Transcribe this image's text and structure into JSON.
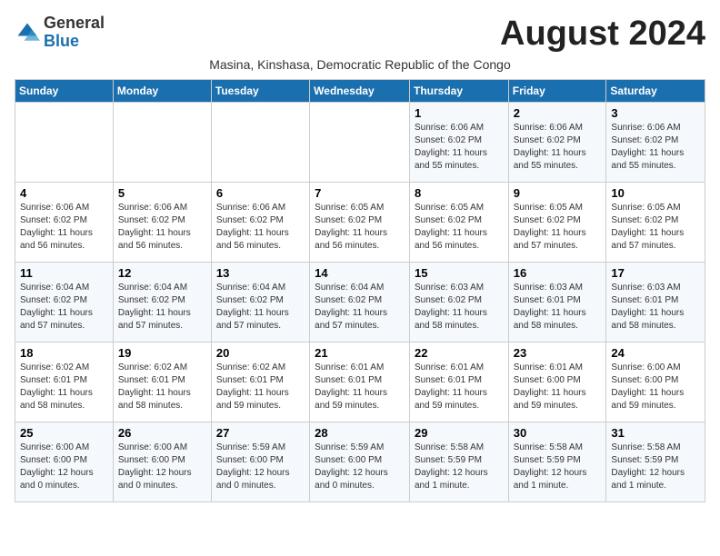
{
  "header": {
    "logo_line1": "General",
    "logo_line2": "Blue",
    "month_title": "August 2024",
    "subtitle": "Masina, Kinshasa, Democratic Republic of the Congo"
  },
  "columns": [
    "Sunday",
    "Monday",
    "Tuesday",
    "Wednesday",
    "Thursday",
    "Friday",
    "Saturday"
  ],
  "weeks": [
    [
      {
        "day": "",
        "info": ""
      },
      {
        "day": "",
        "info": ""
      },
      {
        "day": "",
        "info": ""
      },
      {
        "day": "",
        "info": ""
      },
      {
        "day": "1",
        "info": "Sunrise: 6:06 AM\nSunset: 6:02 PM\nDaylight: 11 hours\nand 55 minutes."
      },
      {
        "day": "2",
        "info": "Sunrise: 6:06 AM\nSunset: 6:02 PM\nDaylight: 11 hours\nand 55 minutes."
      },
      {
        "day": "3",
        "info": "Sunrise: 6:06 AM\nSunset: 6:02 PM\nDaylight: 11 hours\nand 55 minutes."
      }
    ],
    [
      {
        "day": "4",
        "info": "Sunrise: 6:06 AM\nSunset: 6:02 PM\nDaylight: 11 hours\nand 56 minutes."
      },
      {
        "day": "5",
        "info": "Sunrise: 6:06 AM\nSunset: 6:02 PM\nDaylight: 11 hours\nand 56 minutes."
      },
      {
        "day": "6",
        "info": "Sunrise: 6:06 AM\nSunset: 6:02 PM\nDaylight: 11 hours\nand 56 minutes."
      },
      {
        "day": "7",
        "info": "Sunrise: 6:05 AM\nSunset: 6:02 PM\nDaylight: 11 hours\nand 56 minutes."
      },
      {
        "day": "8",
        "info": "Sunrise: 6:05 AM\nSunset: 6:02 PM\nDaylight: 11 hours\nand 56 minutes."
      },
      {
        "day": "9",
        "info": "Sunrise: 6:05 AM\nSunset: 6:02 PM\nDaylight: 11 hours\nand 57 minutes."
      },
      {
        "day": "10",
        "info": "Sunrise: 6:05 AM\nSunset: 6:02 PM\nDaylight: 11 hours\nand 57 minutes."
      }
    ],
    [
      {
        "day": "11",
        "info": "Sunrise: 6:04 AM\nSunset: 6:02 PM\nDaylight: 11 hours\nand 57 minutes."
      },
      {
        "day": "12",
        "info": "Sunrise: 6:04 AM\nSunset: 6:02 PM\nDaylight: 11 hours\nand 57 minutes."
      },
      {
        "day": "13",
        "info": "Sunrise: 6:04 AM\nSunset: 6:02 PM\nDaylight: 11 hours\nand 57 minutes."
      },
      {
        "day": "14",
        "info": "Sunrise: 6:04 AM\nSunset: 6:02 PM\nDaylight: 11 hours\nand 57 minutes."
      },
      {
        "day": "15",
        "info": "Sunrise: 6:03 AM\nSunset: 6:02 PM\nDaylight: 11 hours\nand 58 minutes."
      },
      {
        "day": "16",
        "info": "Sunrise: 6:03 AM\nSunset: 6:01 PM\nDaylight: 11 hours\nand 58 minutes."
      },
      {
        "day": "17",
        "info": "Sunrise: 6:03 AM\nSunset: 6:01 PM\nDaylight: 11 hours\nand 58 minutes."
      }
    ],
    [
      {
        "day": "18",
        "info": "Sunrise: 6:02 AM\nSunset: 6:01 PM\nDaylight: 11 hours\nand 58 minutes."
      },
      {
        "day": "19",
        "info": "Sunrise: 6:02 AM\nSunset: 6:01 PM\nDaylight: 11 hours\nand 58 minutes."
      },
      {
        "day": "20",
        "info": "Sunrise: 6:02 AM\nSunset: 6:01 PM\nDaylight: 11 hours\nand 59 minutes."
      },
      {
        "day": "21",
        "info": "Sunrise: 6:01 AM\nSunset: 6:01 PM\nDaylight: 11 hours\nand 59 minutes."
      },
      {
        "day": "22",
        "info": "Sunrise: 6:01 AM\nSunset: 6:01 PM\nDaylight: 11 hours\nand 59 minutes."
      },
      {
        "day": "23",
        "info": "Sunrise: 6:01 AM\nSunset: 6:00 PM\nDaylight: 11 hours\nand 59 minutes."
      },
      {
        "day": "24",
        "info": "Sunrise: 6:00 AM\nSunset: 6:00 PM\nDaylight: 11 hours\nand 59 minutes."
      }
    ],
    [
      {
        "day": "25",
        "info": "Sunrise: 6:00 AM\nSunset: 6:00 PM\nDaylight: 12 hours\nand 0 minutes."
      },
      {
        "day": "26",
        "info": "Sunrise: 6:00 AM\nSunset: 6:00 PM\nDaylight: 12 hours\nand 0 minutes."
      },
      {
        "day": "27",
        "info": "Sunrise: 5:59 AM\nSunset: 6:00 PM\nDaylight: 12 hours\nand 0 minutes."
      },
      {
        "day": "28",
        "info": "Sunrise: 5:59 AM\nSunset: 6:00 PM\nDaylight: 12 hours\nand 0 minutes."
      },
      {
        "day": "29",
        "info": "Sunrise: 5:58 AM\nSunset: 5:59 PM\nDaylight: 12 hours\nand 1 minute."
      },
      {
        "day": "30",
        "info": "Sunrise: 5:58 AM\nSunset: 5:59 PM\nDaylight: 12 hours\nand 1 minute."
      },
      {
        "day": "31",
        "info": "Sunrise: 5:58 AM\nSunset: 5:59 PM\nDaylight: 12 hours\nand 1 minute."
      }
    ]
  ]
}
